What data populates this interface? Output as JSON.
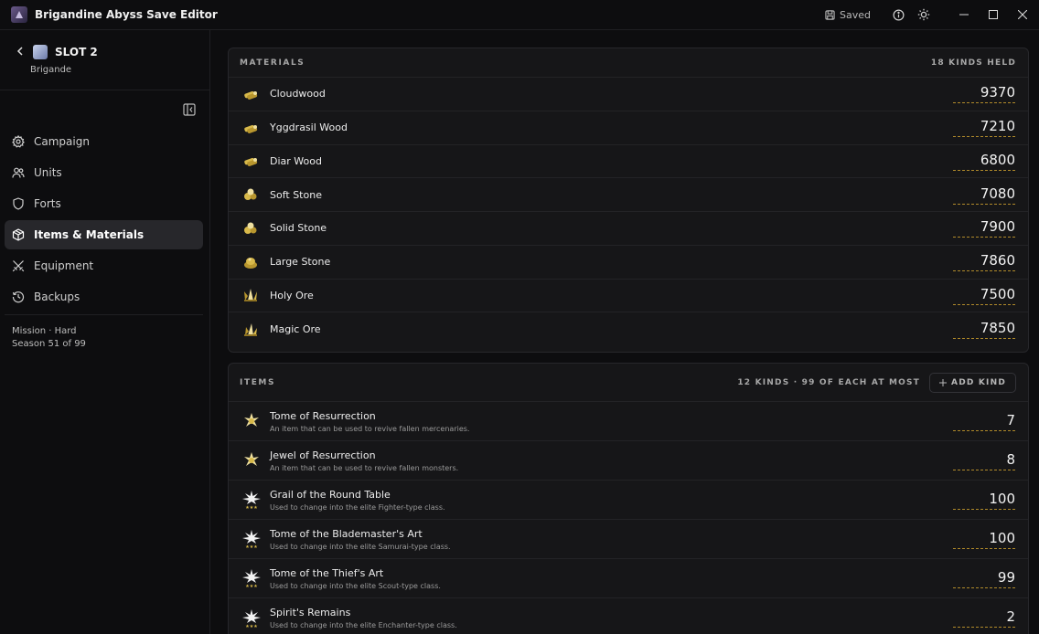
{
  "titlebar": {
    "app_title": "Brigandine Abyss Save Editor",
    "saved_label": "Saved"
  },
  "sidebar": {
    "slot_title": "SLOT 2",
    "slot_subtitle": "Brigande",
    "nav": [
      {
        "label": "Campaign",
        "icon": "gear-icon",
        "active": false
      },
      {
        "label": "Units",
        "icon": "users-icon",
        "active": false
      },
      {
        "label": "Forts",
        "icon": "shield-icon",
        "active": false
      },
      {
        "label": "Items & Materials",
        "icon": "box-icon",
        "active": true
      },
      {
        "label": "Equipment",
        "icon": "swords-icon",
        "active": false
      },
      {
        "label": "Backups",
        "icon": "history-icon",
        "active": false
      }
    ],
    "meta_line1": "Mission · Hard",
    "meta_line2": "Season 51 of 99"
  },
  "materials": {
    "title": "MATERIALS",
    "count": "18 KINDS HELD",
    "rows": [
      {
        "name": "Cloudwood",
        "qty": "9370",
        "icon": "wood-icon"
      },
      {
        "name": "Yggdrasil Wood",
        "qty": "7210",
        "icon": "wood-icon"
      },
      {
        "name": "Diar Wood",
        "qty": "6800",
        "icon": "wood-icon"
      },
      {
        "name": "Soft Stone",
        "qty": "7080",
        "icon": "stone-icon"
      },
      {
        "name": "Solid Stone",
        "qty": "7900",
        "icon": "stone-icon"
      },
      {
        "name": "Large Stone",
        "qty": "7860",
        "icon": "stone-icon"
      },
      {
        "name": "Holy Ore",
        "qty": "7500",
        "icon": "ore-icon"
      },
      {
        "name": "Magic Ore",
        "qty": "7850",
        "icon": "ore-icon"
      }
    ]
  },
  "items": {
    "title": "ITEMS",
    "count": "12 KINDS · 99 OF EACH AT MOST",
    "add_label": "ADD KIND",
    "rows": [
      {
        "name": "Tome of Resurrection",
        "desc": "An item that can be used to revive fallen mercenaries.",
        "qty": "7",
        "icon": "resurrection-icon"
      },
      {
        "name": "Jewel of Resurrection",
        "desc": "An item that can be used to revive fallen monsters.",
        "qty": "8",
        "icon": "resurrection-icon"
      },
      {
        "name": "Grail of the Round Table",
        "desc": "Used to change into the elite Fighter-type class.",
        "qty": "100",
        "icon": "elite-class-icon"
      },
      {
        "name": "Tome of the Blademaster's Art",
        "desc": "Used to change into the elite Samurai-type class.",
        "qty": "100",
        "icon": "elite-class-icon"
      },
      {
        "name": "Tome of the Thief's Art",
        "desc": "Used to change into the elite Scout-type class.",
        "qty": "99",
        "icon": "elite-class-icon"
      },
      {
        "name": "Spirit's Remains",
        "desc": "Used to change into the elite Enchanter-type class.",
        "qty": "2",
        "icon": "elite-class-icon"
      }
    ]
  },
  "colors": {
    "accent_gold": "#d8b94a",
    "background": "#0d0d0f",
    "panel": "#161618"
  }
}
